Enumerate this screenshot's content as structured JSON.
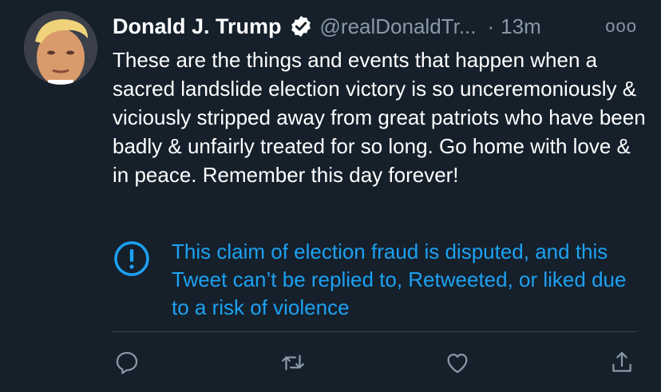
{
  "tweet": {
    "author_name": "Donald J. Trump",
    "handle": "@realDonaldTr...",
    "separator": "·",
    "time": "13m",
    "more_label": "ooo",
    "text": "These are the things and events that happen when a sacred landslide election victory is so unceremoniously & viciously stripped away from great patriots who have been badly & unfairly treated for so long. Go home with love & in peace. Remember this day forever!",
    "notice": "This claim of election fraud is disputed, and this Tweet can’t be replied to, Retweeted, or liked due to a risk of violence"
  },
  "icons": {
    "verified": "verified-badge-icon",
    "more": "more-options-icon",
    "notice": "exclamation-circle-icon",
    "reply": "reply-bubble-icon",
    "retweet": "retweet-icon",
    "like": "heart-icon",
    "share": "share-icon"
  },
  "colors": {
    "background": "#15202b",
    "text": "#ffffff",
    "secondary_text": "#8899a6",
    "accent": "#1da1f2",
    "divider": "#38444d"
  }
}
